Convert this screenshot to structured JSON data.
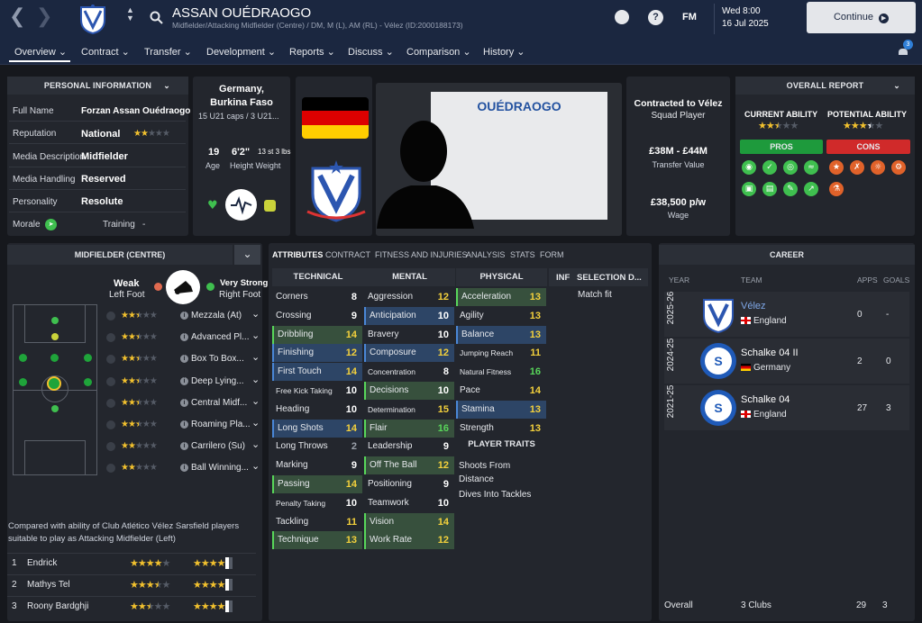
{
  "header": {
    "player_name": "ASSAN OUÉDRAOGO",
    "player_subtitle": "Midfielder/Attacking Midfielder (Centre) / DM, M (L), AM (RL) - Vélez (ID:2000188173)",
    "fm_label": "FM",
    "day": "Wed 8:00",
    "date": "16 Jul 2025",
    "continue_label": "Continue",
    "notification_count": "3"
  },
  "nav": {
    "items": [
      "Overview",
      "Contract",
      "Transfer",
      "Development",
      "Reports",
      "Discuss",
      "Comparison",
      "History"
    ]
  },
  "personal": {
    "title": "PERSONAL INFORMATION",
    "rows": [
      {
        "label": "Full Name",
        "value": "Forzan Assan Ouédraogo"
      },
      {
        "label": "Reputation",
        "value": "National"
      },
      {
        "label": "Media Description",
        "value": "Midfielder"
      },
      {
        "label": "Media Handling",
        "value": "Reserved"
      },
      {
        "label": "Personality",
        "value": "Resolute"
      }
    ],
    "morale_label": "Morale",
    "training_label": "Training",
    "training_value": "-"
  },
  "nation": {
    "country": "Germany,",
    "country2": "Burkina Faso",
    "caps": "15 U21 caps / 3 U21...",
    "age": "19",
    "age_label": "Age",
    "height": "6'2\"",
    "weight": "13 st 3 lbs",
    "hw_label": "Height Weight"
  },
  "shirt_name": "OUÉDRAOGO",
  "contract": {
    "status": "Contracted to Vélez",
    "role": "Squad Player",
    "value": "£38M - £44M",
    "value_label": "Transfer Value",
    "wage": "£38,500 p/w",
    "wage_label": "Wage"
  },
  "overall_report": {
    "title": "OVERALL REPORT",
    "ca_label": "CURRENT ABILITY",
    "pa_label": "POTENTIAL ABILITY",
    "pros_label": "PROS",
    "cons_label": "CONS",
    "current_ability_stars": 2.5,
    "potential_ability_stars": 3.5
  },
  "position": {
    "title": "MIDFIELDER (CENTRE)",
    "weak_label": "Weak",
    "weak_foot": "Left Foot",
    "strong_label": "Very Strong",
    "strong_foot": "Right Foot",
    "roles": [
      {
        "name": "Mezzala (At)",
        "stars": 2.5
      },
      {
        "name": "Advanced Pl...",
        "stars": 2.5
      },
      {
        "name": "Box To Box...",
        "stars": 2.5
      },
      {
        "name": "Deep Lying...",
        "stars": 2.5
      },
      {
        "name": "Central Midf...",
        "stars": 2.5
      },
      {
        "name": "Roaming Pla...",
        "stars": 2.5
      },
      {
        "name": "Carrilero (Su)",
        "stars": 2
      },
      {
        "name": "Ball Winning...",
        "stars": 2
      }
    ],
    "comparison_text": "Compared with ability of Club Atlético Vélez Sarsfield players suitable to play as Attacking Midfielder (Left)",
    "comparison": [
      {
        "rank": "1",
        "name": "Endrick",
        "ca": 4,
        "pa": 4.5
      },
      {
        "rank": "2",
        "name": "Mathys Tel",
        "ca": 3.5,
        "pa": 4.5
      },
      {
        "rank": "3",
        "name": "Roony Bardghji",
        "ca": 2.5,
        "pa": 4.5
      }
    ]
  },
  "tabs": [
    "ATTRIBUTES",
    "CONTRACT",
    "FITNESS AND INJURIES",
    "ANALYSIS",
    "STATS",
    "FORM"
  ],
  "attributes": {
    "technical_title": "TECHNICAL",
    "mental_title": "MENTAL",
    "physical_title": "PHYSICAL",
    "technical": [
      {
        "name": "Corners",
        "value": "8",
        "hl": ""
      },
      {
        "name": "Crossing",
        "value": "9",
        "hl": ""
      },
      {
        "name": "Dribbling",
        "value": "14",
        "hl": "green"
      },
      {
        "name": "Finishing",
        "value": "12",
        "hl": "blue"
      },
      {
        "name": "First Touch",
        "value": "14",
        "hl": "blue"
      },
      {
        "name": "Free Kick Taking",
        "value": "10",
        "hl": ""
      },
      {
        "name": "Heading",
        "value": "10",
        "hl": ""
      },
      {
        "name": "Long Shots",
        "value": "14",
        "hl": "blue"
      },
      {
        "name": "Long Throws",
        "value": "2",
        "hl": ""
      },
      {
        "name": "Marking",
        "value": "9",
        "hl": ""
      },
      {
        "name": "Passing",
        "value": "14",
        "hl": "green"
      },
      {
        "name": "Penalty Taking",
        "value": "10",
        "hl": ""
      },
      {
        "name": "Tackling",
        "value": "11",
        "hl": ""
      },
      {
        "name": "Technique",
        "value": "13",
        "hl": "green"
      }
    ],
    "mental": [
      {
        "name": "Aggression",
        "value": "12",
        "hl": ""
      },
      {
        "name": "Anticipation",
        "value": "10",
        "hl": "blue"
      },
      {
        "name": "Bravery",
        "value": "10",
        "hl": ""
      },
      {
        "name": "Composure",
        "value": "12",
        "hl": "blue"
      },
      {
        "name": "Concentration",
        "value": "8",
        "hl": ""
      },
      {
        "name": "Decisions",
        "value": "10",
        "hl": "green"
      },
      {
        "name": "Determination",
        "value": "15",
        "hl": ""
      },
      {
        "name": "Flair",
        "value": "16",
        "hl": "green"
      },
      {
        "name": "Leadership",
        "value": "9",
        "hl": ""
      },
      {
        "name": "Off The Ball",
        "value": "12",
        "hl": "green"
      },
      {
        "name": "Positioning",
        "value": "9",
        "hl": ""
      },
      {
        "name": "Teamwork",
        "value": "10",
        "hl": ""
      },
      {
        "name": "Vision",
        "value": "14",
        "hl": "green"
      },
      {
        "name": "Work Rate",
        "value": "12",
        "hl": "green"
      }
    ],
    "physical": [
      {
        "name": "Acceleration",
        "value": "13",
        "hl": "green"
      },
      {
        "name": "Agility",
        "value": "13",
        "hl": ""
      },
      {
        "name": "Balance",
        "value": "13",
        "hl": "blue"
      },
      {
        "name": "Jumping Reach",
        "value": "11",
        "hl": ""
      },
      {
        "name": "Natural Fitness",
        "value": "16",
        "hl": ""
      },
      {
        "name": "Pace",
        "value": "14",
        "hl": ""
      },
      {
        "name": "Stamina",
        "value": "13",
        "hl": "blue"
      },
      {
        "name": "Strength",
        "value": "13",
        "hl": ""
      }
    ],
    "traits_title": "PLAYER TRAITS",
    "traits": [
      "Shoots From Distance",
      "Dives Into Tackles"
    ],
    "inf_label": "INF",
    "selection_label": "SELECTION D...",
    "selection_value": "Match fit"
  },
  "career": {
    "title": "CAREER",
    "col_year": "YEAR",
    "col_team": "TEAM",
    "col_apps": "APPS",
    "col_goals": "GOALS",
    "rows": [
      {
        "year": "2025-26",
        "team": "Vélez",
        "country": "England",
        "apps": "0",
        "goals": "-"
      },
      {
        "year": "2024-25",
        "team": "Schalke 04 II",
        "country": "Germany",
        "apps": "2",
        "goals": "0"
      },
      {
        "year": "2021-25",
        "team": "Schalke 04",
        "country": "England",
        "apps": "27",
        "goals": "3"
      }
    ],
    "overall_label": "Overall",
    "overall_clubs": "3 Clubs",
    "overall_apps": "29",
    "overall_goals": "3"
  },
  "colors": {
    "header_bg": "#1b2740",
    "panel_bg": "#23262d",
    "green": "#58d65a",
    "yellow": "#f4d13c",
    "pros": "#1e9a3c",
    "cons": "#d02a2a",
    "highlight_green": "#37503d",
    "highlight_blue": "#2d4566"
  }
}
